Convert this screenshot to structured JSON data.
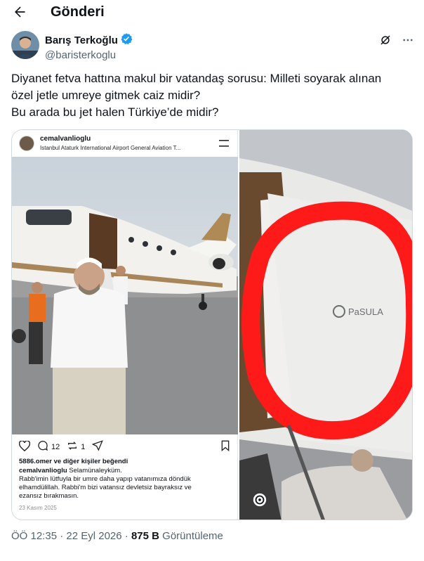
{
  "header": {
    "title": "Gönderi"
  },
  "author": {
    "name": "Barış Terkoğlu",
    "handle": "@baristerkoglu"
  },
  "tweet": {
    "lines": [
      "Diyanet fetva hattına makul bir vatandaş sorusu: Milleti soyarak alınan",
      "özel jetle umreye gitmek caiz midir?",
      "Bu arada bu jet halen Türkiye’de midir?"
    ]
  },
  "instagram": {
    "username": "cemalvanlioglu",
    "location": "Istanbul Ataturk International Airport General Aviation T...",
    "comment_count": "12",
    "share_count": "1",
    "likes_text": "5886.omer ve diğer kişiler beğendi",
    "caption_user": "cemalvanlioglu",
    "caption_first": "Selamünaleyküm.",
    "caption_lines": [
      "Rabb'imin lütfuyla bir umre daha yapıp vatanımıza döndük",
      "elhamdülillah. Rabbi'm bizi vatansız devletsiz bayraksız ve",
      "ezansız bırakmasın."
    ],
    "date": "23 Kasım 2025",
    "jet_logo_text": "PaSULA"
  },
  "meta": {
    "time": "ÖÖ 12:35",
    "date": "22 Eyl 2026",
    "views": "875 B",
    "views_label": "Görüntüleme"
  },
  "colors": {
    "verified": "#1d9bf0",
    "text": "#0f1419",
    "secondary": "#536471",
    "annotation_red": "#ff1a1a"
  },
  "icons": [
    "back-arrow-icon",
    "verified-badge-icon",
    "grok-icon",
    "more-icon",
    "heart-icon",
    "comment-icon",
    "repost-icon",
    "send-icon",
    "bookmark-icon",
    "alt-text-icon"
  ]
}
